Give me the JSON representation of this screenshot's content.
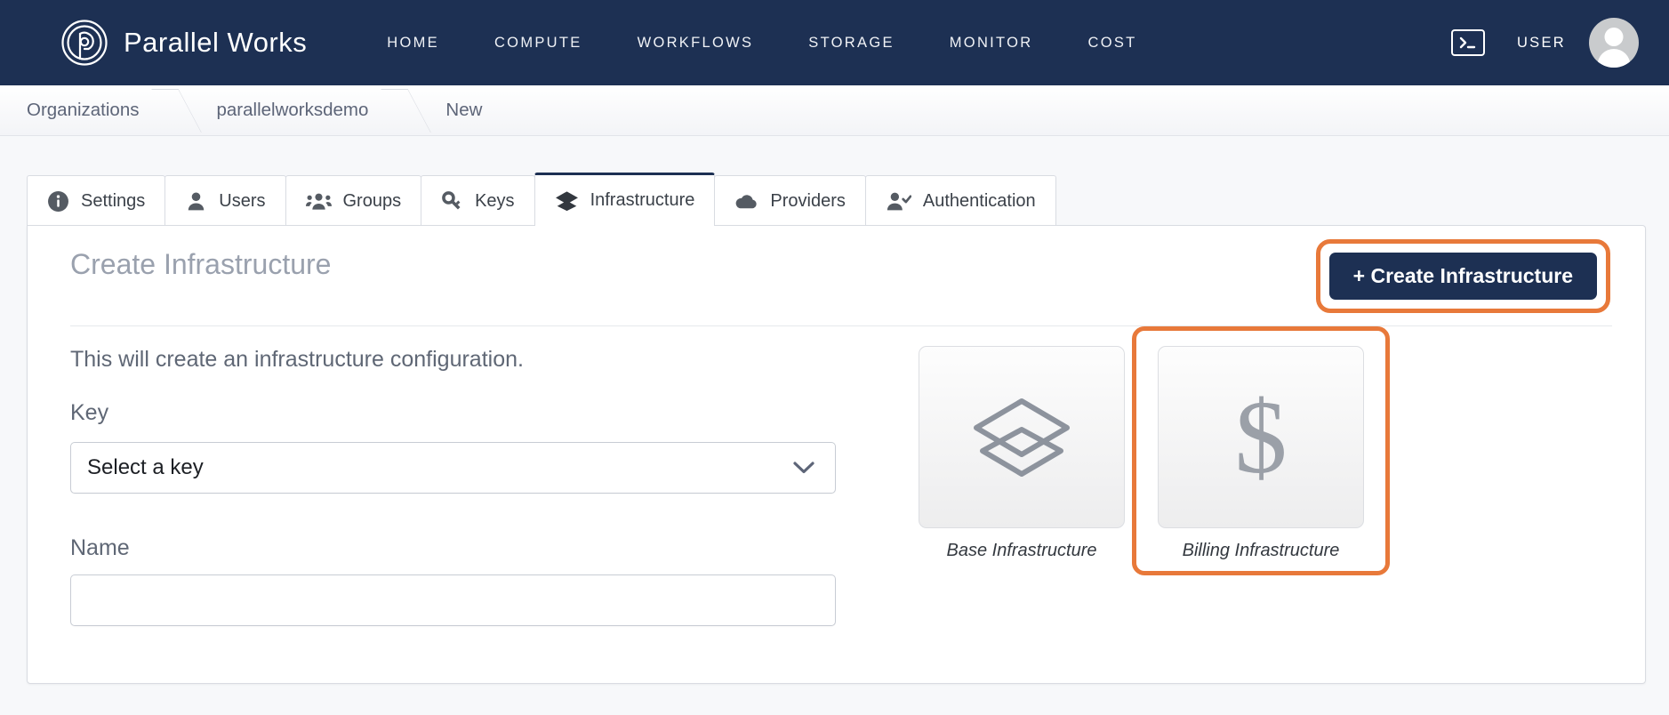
{
  "colors": {
    "navy": "#1d3053",
    "orange_highlight": "#e8793a",
    "page_bg": "#f7f8fa",
    "muted_text": "#5f6775"
  },
  "topnav": {
    "brand": "Parallel Works",
    "brand_logo_icon": "parallel-works-logo-icon",
    "links": [
      {
        "label": "HOME"
      },
      {
        "label": "COMPUTE"
      },
      {
        "label": "WORKFLOWS"
      },
      {
        "label": "STORAGE"
      },
      {
        "label": "MONITOR"
      },
      {
        "label": "COST"
      }
    ],
    "terminal_icon": "terminal-icon",
    "user_label": "USER",
    "avatar_icon": "user-avatar-icon"
  },
  "breadcrumb": {
    "items": [
      {
        "label": "Organizations"
      },
      {
        "label": "parallelworksdemo"
      },
      {
        "label": "New"
      }
    ]
  },
  "tabs": [
    {
      "label": "Settings",
      "icon": "info-circle-icon",
      "active": false
    },
    {
      "label": "Users",
      "icon": "user-icon",
      "active": false
    },
    {
      "label": "Groups",
      "icon": "users-group-icon",
      "active": false
    },
    {
      "label": "Keys",
      "icon": "key-icon",
      "active": false
    },
    {
      "label": "Infrastructure",
      "icon": "layers-icon",
      "active": true
    },
    {
      "label": "Providers",
      "icon": "cloud-icon",
      "active": false
    },
    {
      "label": "Authentication",
      "icon": "user-check-icon",
      "active": false
    }
  ],
  "main": {
    "title": "Create Infrastructure",
    "create_button": "+ Create Infrastructure",
    "create_button_highlighted": true,
    "subtitle": "This will create an infrastructure configuration.",
    "key_field": {
      "label": "Key",
      "value": "Select a key",
      "chevron_icon": "chevron-down-icon"
    },
    "name_field": {
      "label": "Name",
      "value": "",
      "placeholder": ""
    },
    "type_options": [
      {
        "caption": "Base Infrastructure",
        "icon": "layers-stack-icon",
        "highlighted": false
      },
      {
        "caption": "Billing Infrastructure",
        "icon": "dollar-sign-icon",
        "glyph": "$",
        "highlighted": true
      }
    ]
  }
}
